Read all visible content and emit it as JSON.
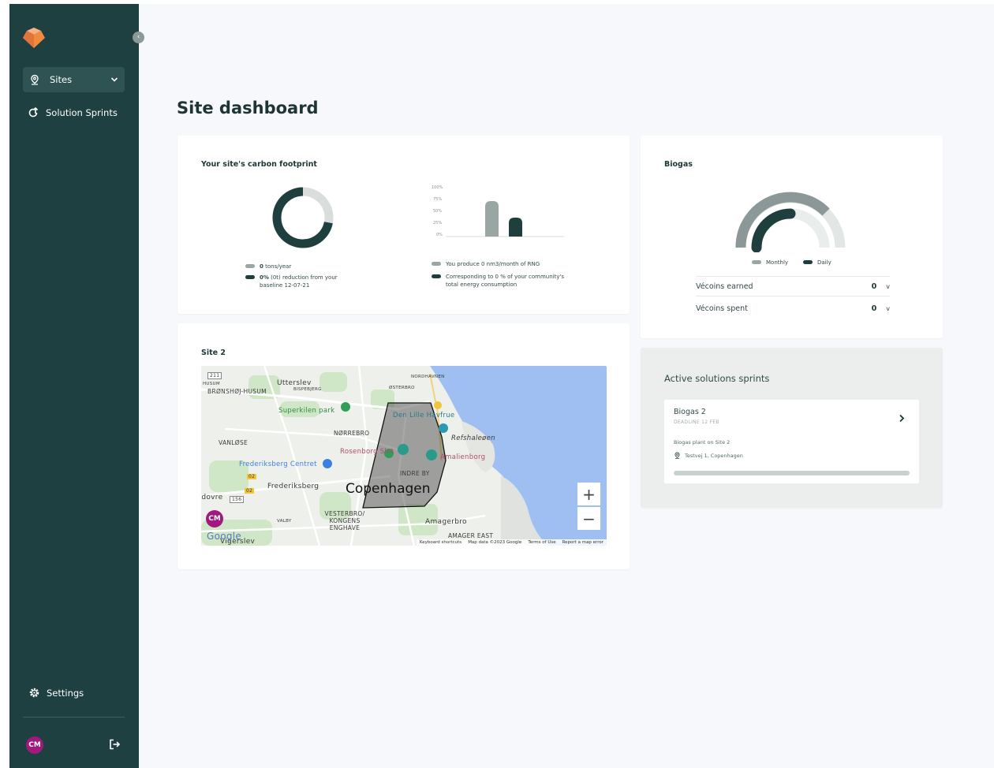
{
  "colors": {
    "sidebar": "#1e4040",
    "primary": "#1f3f3f",
    "secondary": "#9aa6a3",
    "accent": "#f08a3c",
    "avatar": "#a3187f",
    "map_water": "#9fbff3"
  },
  "sidebar": {
    "collapse_icon": "chevron-left-icon",
    "sites_label": "Sites",
    "sprints_label": "Solution Sprints",
    "settings_label": "Settings",
    "user_initials": "CM"
  },
  "page": {
    "title": "Site dashboard"
  },
  "carbon": {
    "title": "Your site's carbon footprint",
    "legend_tons_value": "0",
    "legend_tons_text": "tons/year",
    "legend_reduction_value": "0%",
    "legend_reduction_text": "(0t) reduction from your baseline 12-07-21",
    "bar_ticks": [
      "100%",
      "75%",
      "50%",
      "25%",
      "0%"
    ],
    "bar_values": [
      {
        "name": "produced",
        "value": 75
      },
      {
        "name": "share",
        "value": 40
      }
    ],
    "legend_produce": "You produce 0 nm3/month of RNG",
    "legend_corresponding": "Corresponding to 0 % of your community's total energy consumption"
  },
  "biogas": {
    "title": "Biogas",
    "legend_monthly": "Monthly",
    "legend_daily": "Daily",
    "rows": [
      {
        "label": "Vécoins earned",
        "value": "0"
      },
      {
        "label": "Vécoins spent",
        "value": "0"
      }
    ]
  },
  "site": {
    "title": "Site 2",
    "map": {
      "city": "Copenhagen",
      "labels": [
        "Utterslev",
        "BRØNSHØJ-HUSUM",
        "BISPEBJERG",
        "ØSTERBRO",
        "NORDHAVNEN",
        "Superkilen park",
        "Den Lille Havfrue",
        "NØRREBRO",
        "VANLØSE",
        "Refshaleøen",
        "Rosenborg Slot",
        "Amalienborg",
        "Frederiksberg Centret",
        "INDRE BY",
        "Frederiksberg",
        "Rødovre",
        "VESTERBRO/ KONGENS ENGHAVE",
        "VALBY",
        "Amagerbro",
        "AMAGER EAST",
        "Vigerslev",
        "HUSUM"
      ],
      "road_badges": [
        "211",
        "156",
        "02",
        "02"
      ],
      "zoom_in": "+",
      "zoom_out": "−",
      "google": "Google",
      "footer": [
        "Keyboard shortcuts",
        "Map data ©2023 Google",
        "Terms of Use",
        "Report a map error"
      ],
      "user_initials": "CM"
    }
  },
  "sprints": {
    "title": "Active solutions sprints",
    "item": {
      "name": "Biogas 2",
      "deadline": "DEADLINE 12 FEB",
      "description": "Biogas plant on Site 2",
      "location": "Testvej 1, Copenhagen",
      "progress": 0
    }
  }
}
